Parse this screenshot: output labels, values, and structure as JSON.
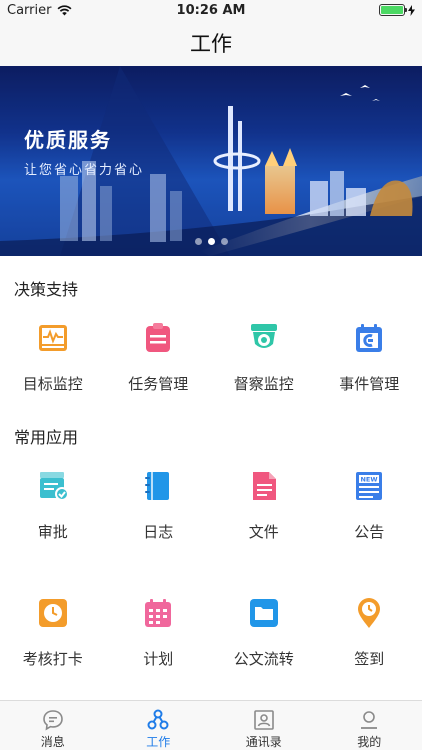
{
  "status_bar": {
    "carrier": "Carrier",
    "time": "10:26 AM",
    "battery_level": 1.0
  },
  "nav": {
    "title": "工作"
  },
  "banner": {
    "title": "优质服务",
    "subtitle": "让您省心省力省心",
    "slide_count": 3,
    "active_slide": 1
  },
  "decision": {
    "title": "决策支持",
    "items": [
      {
        "label": "目标监控",
        "icon": "monitor-chart-icon",
        "color": "#f39c2b"
      },
      {
        "label": "任务管理",
        "icon": "clipboard-icon",
        "color": "#f0577f"
      },
      {
        "label": "督察监控",
        "icon": "camera-icon",
        "color": "#2fc6a8"
      },
      {
        "label": "事件管理",
        "icon": "calendar-event-icon",
        "color": "#3a7ee8"
      }
    ]
  },
  "common": {
    "title": "常用应用",
    "items": [
      {
        "label": "审批",
        "icon": "approval-icon",
        "color": "#3bbfcf"
      },
      {
        "label": "日志",
        "icon": "notebook-icon",
        "color": "#2196e8"
      },
      {
        "label": "文件",
        "icon": "file-icon",
        "color": "#f0577f"
      },
      {
        "label": "公告",
        "icon": "news-icon",
        "color": "#3a7ee8"
      },
      {
        "label": "考核打卡",
        "icon": "clock-icon",
        "color": "#f39c2b"
      },
      {
        "label": "计划",
        "icon": "calendar-grid-icon",
        "color": "#f0679c"
      },
      {
        "label": "公文流转",
        "icon": "folder-icon",
        "color": "#2196e8"
      },
      {
        "label": "签到",
        "icon": "location-clock-icon",
        "color": "#f39c2b"
      }
    ]
  },
  "tabs": [
    {
      "label": "消息",
      "icon": "message-icon"
    },
    {
      "label": "工作",
      "icon": "work-nodes-icon"
    },
    {
      "label": "通讯录",
      "icon": "contacts-icon"
    },
    {
      "label": "我的",
      "icon": "profile-icon"
    }
  ],
  "colors": {
    "accent": "#1f7ce8",
    "tab_inactive": "#8a8a8a"
  }
}
